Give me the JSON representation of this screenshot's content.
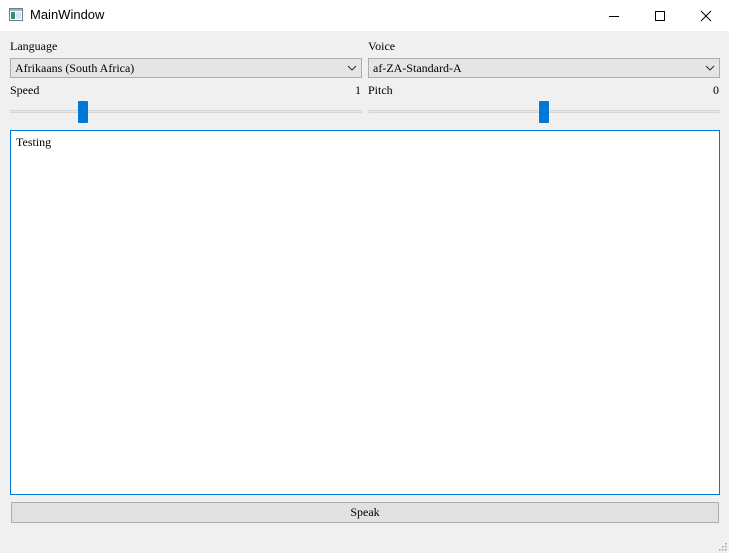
{
  "window": {
    "title": "MainWindow"
  },
  "language": {
    "label": "Language",
    "selected": "Afrikaans (South Africa)"
  },
  "voice": {
    "label": "Voice",
    "selected": "af-ZA-Standard-A"
  },
  "speed": {
    "label": "Speed",
    "value": "1",
    "slider_fraction": 0.2
  },
  "pitch": {
    "label": "Pitch",
    "value": "0",
    "slider_fraction": 0.5
  },
  "editor": {
    "text": "Testing"
  },
  "actions": {
    "speak_label": "Speak"
  },
  "colors": {
    "accent": "#0078d7"
  }
}
